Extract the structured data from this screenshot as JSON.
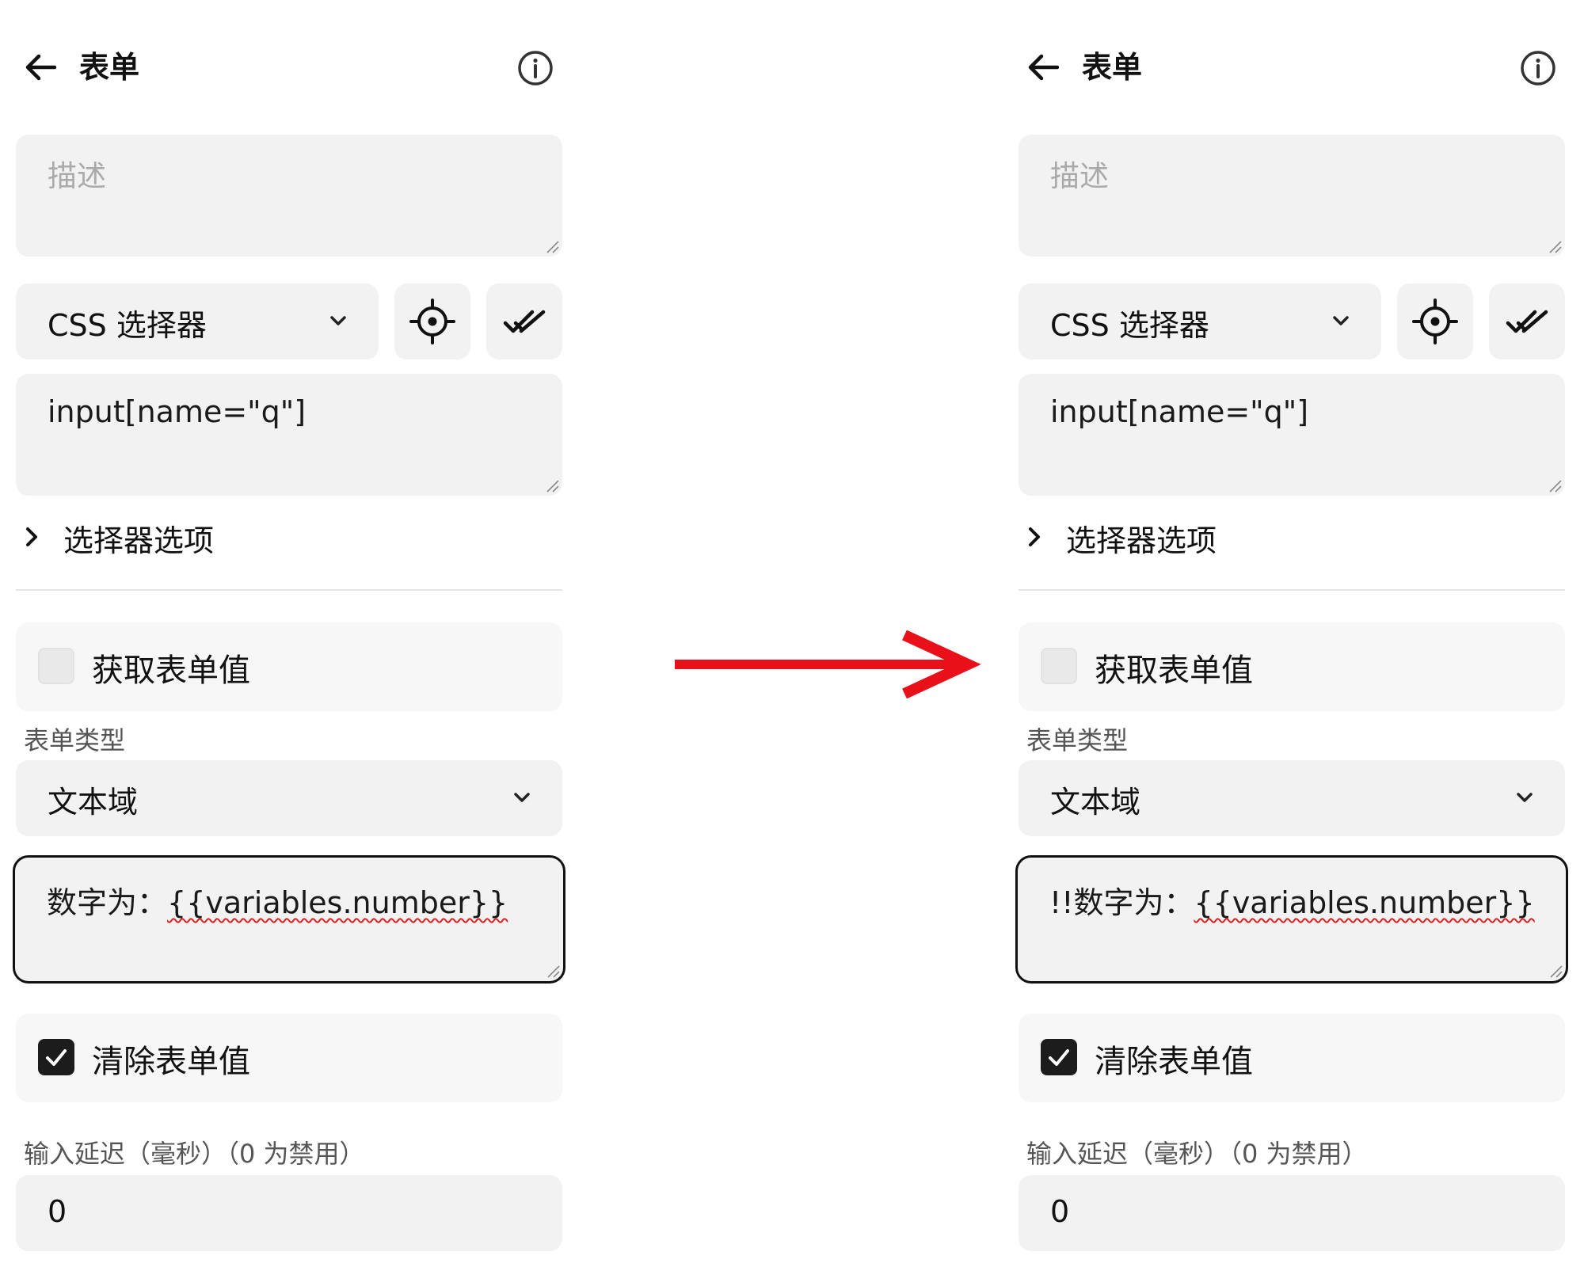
{
  "panels": [
    {
      "header": {
        "title": "表单"
      },
      "description": {
        "placeholder": "描述"
      },
      "selector_type": {
        "value": "CSS 选择器"
      },
      "selector": {
        "value": "input[name=\"q\"]"
      },
      "selector_options": {
        "label": "选择器选项"
      },
      "get_form_value": {
        "label": "获取表单值",
        "checked": false
      },
      "form_type": {
        "label": "表单类型",
        "value": "文本域"
      },
      "value_field": {
        "prefix": "数字为：",
        "variable": "{{variables.number}}"
      },
      "clear_form_value": {
        "label": "清除表单值",
        "checked": true
      },
      "input_delay": {
        "label": "输入延迟（毫秒）（0 为禁用）",
        "value": "0"
      }
    },
    {
      "header": {
        "title": "表单"
      },
      "description": {
        "placeholder": "描述"
      },
      "selector_type": {
        "value": "CSS 选择器"
      },
      "selector": {
        "value": "input[name=\"q\"]"
      },
      "selector_options": {
        "label": "选择器选项"
      },
      "get_form_value": {
        "label": "获取表单值",
        "checked": false
      },
      "form_type": {
        "label": "表单类型",
        "value": "文本域"
      },
      "value_field": {
        "prefix": "!!数字为：",
        "variable": "{{variables.number}}"
      },
      "clear_form_value": {
        "label": "清除表单值",
        "checked": true
      },
      "input_delay": {
        "label": "输入延迟（毫秒）（0 为禁用）",
        "value": "0"
      }
    }
  ],
  "colors": {
    "arrow": "#e8111a",
    "spellcheck": "#e02020",
    "field_bg": "#f2f2f2",
    "checkbox_on": "#1c1c1c"
  },
  "icons": [
    "arrow-left-icon",
    "info-icon",
    "chevron-down-icon",
    "crosshair-icon",
    "double-check-icon",
    "chevron-right-icon",
    "checkmark-icon",
    "resize-handle-icon"
  ]
}
